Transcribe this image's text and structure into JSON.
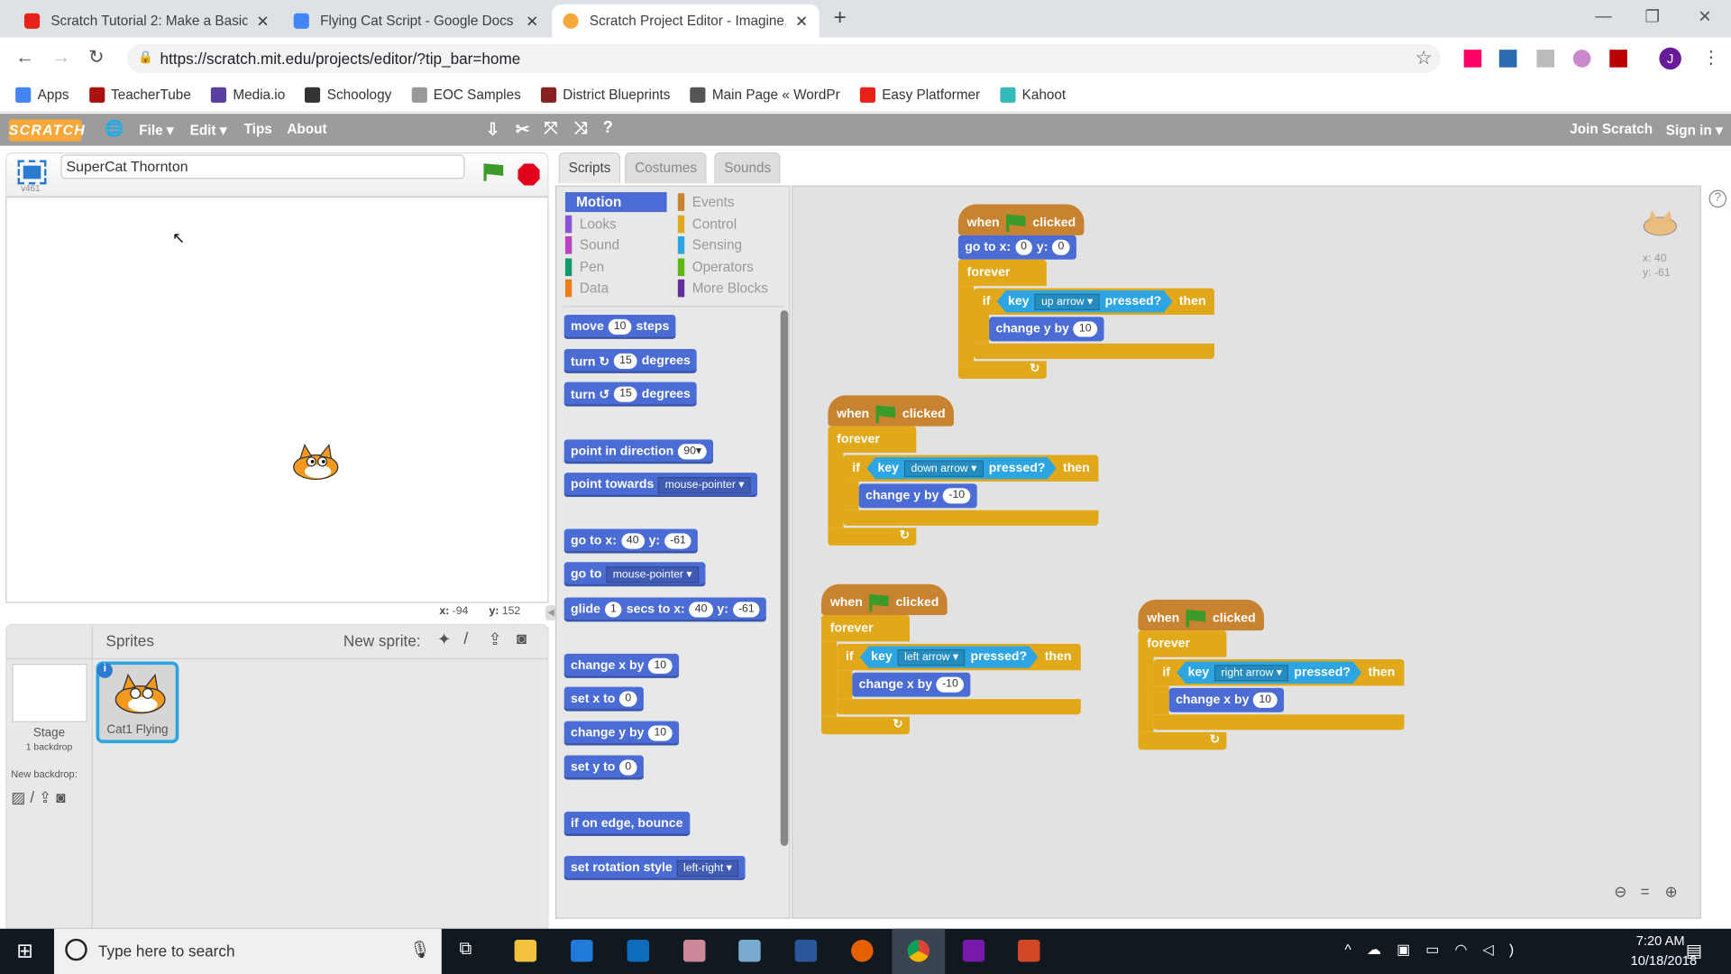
{
  "browser": {
    "tabs": [
      {
        "title": "Scratch Tutorial 2: Make a Basic",
        "icon": "youtube-icon",
        "color": "#e62117"
      },
      {
        "title": "Flying Cat Script - Google Docs",
        "icon": "docs-icon",
        "color": "#4285f4"
      },
      {
        "title": "Scratch Project Editor - Imagine,",
        "icon": "scratch-icon",
        "color": "#f7a83a"
      }
    ],
    "close_glyph": "✕",
    "new_tab": "+",
    "url": "https://scratch.mit.edu/projects/editor/?tip_bar=home",
    "profile_initial": "J",
    "bookmarks": [
      {
        "label": "Apps",
        "color": "#4285f4"
      },
      {
        "label": "TeacherTube",
        "color": "#a11"
      },
      {
        "label": "Media.io",
        "color": "#5a3fa0"
      },
      {
        "label": "Schoology",
        "color": "#333"
      },
      {
        "label": "EOC Samples",
        "color": "#999"
      },
      {
        "label": "District Blueprints",
        "color": "#822"
      },
      {
        "label": "Main Page « WordPr",
        "color": "#555"
      },
      {
        "label": "Easy Platformer",
        "color": "#e62117"
      },
      {
        "label": "Kahoot",
        "color": "#3bb"
      }
    ]
  },
  "scratch": {
    "logo": "SCRATCH",
    "menu": [
      "File ▾",
      "Edit ▾",
      "Tips",
      "About"
    ],
    "join": "Join Scratch",
    "signin": "Sign in ▾",
    "project_title": "SuperCat Thornton",
    "version": "v461",
    "mouse_x_label": "x:",
    "mouse_x": "-94",
    "mouse_y_label": "y:",
    "mouse_y": "152",
    "sprites_header": "Sprites",
    "new_sprite": "New sprite:",
    "stage_label": "Stage",
    "stage_sub": "1 backdrop",
    "new_backdrop": "New backdrop:",
    "sprite_name": "Cat1 Flying",
    "sprite_x": "x: 40",
    "sprite_y": "y: -61",
    "tabs": [
      "Scripts",
      "Costumes",
      "Sounds"
    ],
    "categories": [
      {
        "label": "Motion",
        "color": "#4a6cd4",
        "active": true
      },
      {
        "label": "Events",
        "color": "#c88330"
      },
      {
        "label": "Looks",
        "color": "#8a55d7"
      },
      {
        "label": "Control",
        "color": "#e1a91a"
      },
      {
        "label": "Sound",
        "color": "#bb42c3"
      },
      {
        "label": "Sensing",
        "color": "#2ca5e2"
      },
      {
        "label": "Pen",
        "color": "#0e9a6c"
      },
      {
        "label": "Operators",
        "color": "#5cb712"
      },
      {
        "label": "Data",
        "color": "#ee7d16"
      },
      {
        "label": "More Blocks",
        "color": "#632d99"
      }
    ],
    "palette": [
      [
        {
          "t": "move"
        },
        {
          "n": "10"
        },
        {
          "t": "steps"
        }
      ],
      [
        {
          "t": "turn ↻"
        },
        {
          "n": "15"
        },
        {
          "t": "degrees"
        }
      ],
      [
        {
          "t": "turn ↺"
        },
        {
          "n": "15"
        },
        {
          "t": "degrees"
        }
      ],
      [
        {
          "t": "point in direction"
        },
        {
          "n": "90▾"
        }
      ],
      [
        {
          "t": "point towards"
        },
        {
          "d": "mouse-pointer ▾"
        }
      ],
      [
        {
          "t": "go to x:"
        },
        {
          "n": "40"
        },
        {
          "t": "y:"
        },
        {
          "n": "-61"
        }
      ],
      [
        {
          "t": "go to"
        },
        {
          "d": "mouse-pointer ▾"
        }
      ],
      [
        {
          "t": "glide"
        },
        {
          "n": "1"
        },
        {
          "t": "secs to x:"
        },
        {
          "n": "40"
        },
        {
          "t": "y:"
        },
        {
          "n": "-61"
        }
      ],
      [
        {
          "t": "change x by"
        },
        {
          "n": "10"
        }
      ],
      [
        {
          "t": "set x to"
        },
        {
          "n": "0"
        }
      ],
      [
        {
          "t": "change y by"
        },
        {
          "n": "10"
        }
      ],
      [
        {
          "t": "set y to"
        },
        {
          "n": "0"
        }
      ],
      [
        {
          "t": "if on edge, bounce"
        }
      ],
      [
        {
          "t": "set rotation style"
        },
        {
          "d": "left-right ▾"
        }
      ]
    ],
    "scripts": [
      {
        "hat": [
          "when",
          "clicked"
        ],
        "goto": [
          {
            "t": "go to x:"
          },
          {
            "n": "0"
          },
          {
            "t": "y:"
          },
          {
            "n": "0"
          }
        ],
        "forever": "forever",
        "if": "if",
        "key": "key",
        "keyname": "up arrow ▾",
        "pressed": "pressed?",
        "then": "then",
        "change": [
          {
            "t": "change y by"
          },
          {
            "n": "10"
          }
        ]
      },
      {
        "hat": [
          "when",
          "clicked"
        ],
        "forever": "forever",
        "if": "if",
        "key": "key",
        "keyname": "down arrow ▾",
        "pressed": "pressed?",
        "then": "then",
        "change": [
          {
            "t": "change y by"
          },
          {
            "n": "-10"
          }
        ]
      },
      {
        "hat": [
          "when",
          "clicked"
        ],
        "forever": "forever",
        "if": "if",
        "key": "key",
        "keyname": "left arrow ▾",
        "pressed": "pressed?",
        "then": "then",
        "change": [
          {
            "t": "change x by"
          },
          {
            "n": "-10"
          }
        ]
      },
      {
        "hat": [
          "when",
          "clicked"
        ],
        "forever": "forever",
        "if": "if",
        "key": "key",
        "keyname": "right arrow ▾",
        "pressed": "pressed?",
        "then": "then",
        "change": [
          {
            "t": "change x by"
          },
          {
            "n": "10"
          }
        ]
      }
    ]
  },
  "taskbar": {
    "search_placeholder": "Type here to search",
    "time": "7:20 AM",
    "date": "10/18/2018"
  }
}
